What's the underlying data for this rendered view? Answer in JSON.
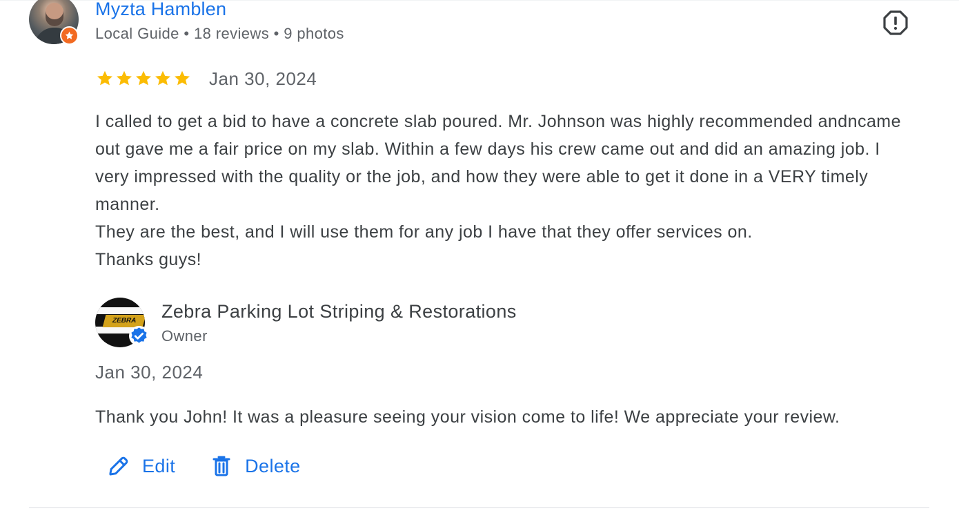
{
  "review": {
    "reviewer": {
      "name": "Myzta Hamblen",
      "meta": "Local Guide • 18 reviews • 9 photos"
    },
    "rating": 5,
    "date": "Jan 30, 2024",
    "paragraphs": [
      "I called to get a bid to have a concrete slab poured. Mr. Johnson was highly recommended andncame out gave me a fair price on my slab. Within a few days his crew came out and did an amazing job. I very impressed with the quality or the job, and how they were able to get it done in a VERY timely manner.",
      "They are the best, and I will use them for any job I have that they offer services on.",
      "Thanks guys!"
    ],
    "icons": {
      "report": "report-icon",
      "star": "star-icon",
      "local_guide": "local-guide-star-icon"
    }
  },
  "owner_reply": {
    "business_name": "Zebra Parking Lot Striping & Restorations",
    "role": "Owner",
    "logo_text": "ZEBRA",
    "date": "Jan 30, 2024",
    "text": "Thank you John! It was a pleasure seeing your vision come to life! We appreciate your review.",
    "icons": {
      "verified": "verified-check-icon"
    }
  },
  "actions": {
    "edit_label": "Edit",
    "delete_label": "Delete",
    "edit_icon": "pencil-icon",
    "delete_icon": "trash-icon"
  },
  "colors": {
    "link_blue": "#1a73e8",
    "text_primary": "#3c4043",
    "text_secondary": "#5f6368",
    "star_yellow": "#fbbc04",
    "badge_orange": "#f26a21",
    "verified_blue": "#1a73e8"
  }
}
